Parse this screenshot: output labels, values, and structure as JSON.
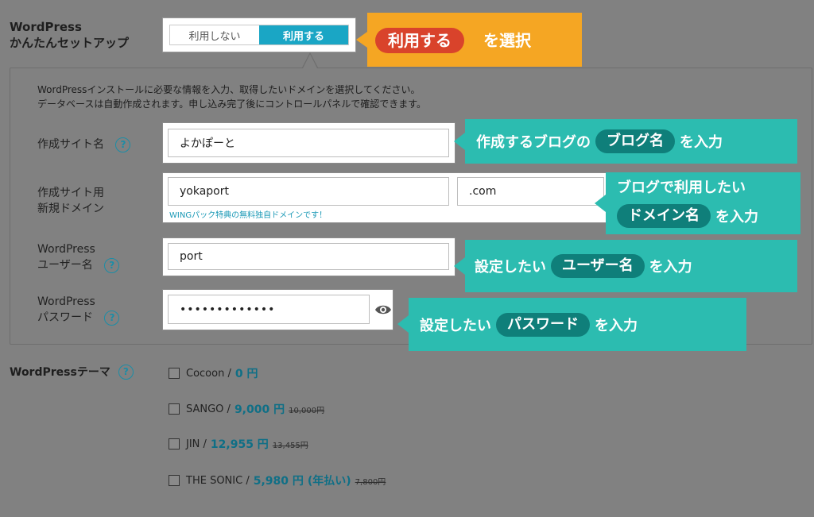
{
  "heading": {
    "line1": "WordPress",
    "line2": "かんたんセットアップ"
  },
  "toggle": {
    "off_label": "利用しない",
    "on_label": "利用する"
  },
  "callout_select": {
    "pill": "利用する",
    "tail": "を選択"
  },
  "intro": {
    "line1": "WordPressインストールに必要な情報を入力、取得したいドメインを選択してください。",
    "line2": "データベースは自動作成されます。申し込み完了後にコントロールパネルで確認できます。"
  },
  "site_name": {
    "label": "作成サイト名",
    "help": "?",
    "value": "よかぽーと"
  },
  "domain": {
    "label1": "作成サイト用",
    "label2": "新規ドメイン",
    "value": "yokaport",
    "tld": ".com",
    "note": "WINGパック特典の無料独自ドメインです！"
  },
  "username": {
    "label1": "WordPress",
    "label2": "ユーザー名",
    "help": "?",
    "value": "port"
  },
  "password": {
    "label1": "WordPress",
    "label2": "パスワード",
    "help": "?",
    "value": "•••••••••••••"
  },
  "callouts": {
    "blog_name": {
      "pre": "作成するブログの",
      "pill": "ブログ名",
      "post": "を入力"
    },
    "domain": {
      "line1": "ブログで利用したい",
      "pill": "ドメイン名",
      "post": "を入力"
    },
    "username": {
      "pre": "設定したい",
      "pill": "ユーザー名",
      "post": "を入力"
    },
    "password": {
      "pre": "設定したい",
      "pill": "パスワード",
      "post": "を入力"
    }
  },
  "theme": {
    "label": "WordPressテーマ",
    "help": "?",
    "options": [
      {
        "name": "Cocoon /",
        "price": "0 円",
        "extra": "",
        "strike": ""
      },
      {
        "name": "SANGO /",
        "price": "9,000 円",
        "extra": "",
        "strike": "10,000円"
      },
      {
        "name": "JIN /",
        "price": "12,955 円",
        "extra": "",
        "strike": "13,455円"
      },
      {
        "name": "THE SONIC /",
        "price": "5,980 円",
        "extra": "(年払い)",
        "strike": "7,800円"
      }
    ]
  },
  "colors": {
    "accent_teal": "#2cbcb0",
    "callout_orange": "#f5a623",
    "toggle_on": "#1aa6c5"
  }
}
